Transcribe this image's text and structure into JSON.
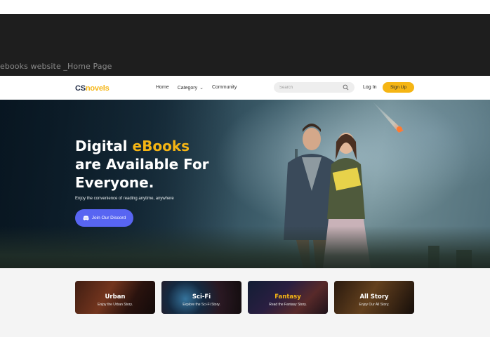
{
  "frame": {
    "title": "ebooks website _Home Page"
  },
  "header": {
    "logo": {
      "part1": "CS",
      "part2": "novels"
    },
    "nav": [
      {
        "label": "Home",
        "dropdown": false
      },
      {
        "label": "Category",
        "dropdown": true
      },
      {
        "label": "Community",
        "dropdown": false
      }
    ],
    "search": {
      "placeholder": "Search",
      "value": ""
    },
    "login_label": "Log In",
    "signup_label": "Sign Up"
  },
  "hero": {
    "headline_part1": "Digital ",
    "headline_highlight": "eBooks",
    "headline_part2": "are Available For Everyone.",
    "subline": "Enjoy the convenience of reading anytime, anywhere",
    "cta_label": "Join Our Discord"
  },
  "categories": [
    {
      "title": "Urban",
      "subtitle": "Enjoy the Urban Story."
    },
    {
      "title": "Sci-Fi",
      "subtitle": "Explore the Sci-Fi Story."
    },
    {
      "title": "Fantasy",
      "subtitle": "Read the Fantasy Story."
    },
    {
      "title": "All Story",
      "subtitle": "Enjoy Our All Story."
    }
  ],
  "colors": {
    "accent": "#f5b514",
    "brand_dark": "#1f2a44",
    "discord": "#5865f2",
    "frame_bar": "#1e1e1e"
  },
  "icons": [
    "search-icon",
    "chevron-down-icon",
    "discord-icon"
  ]
}
